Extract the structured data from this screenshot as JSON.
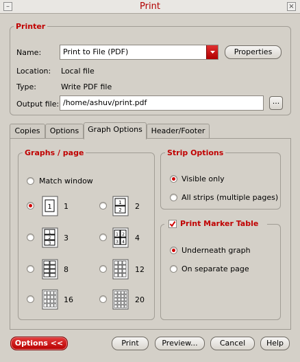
{
  "window": {
    "title": "Print",
    "minimize_glyph": "–",
    "close_glyph": "×"
  },
  "printer": {
    "group_title": "Printer",
    "name_label": "Name:",
    "name_value": "Print to File (PDF)",
    "properties_button": "Properties",
    "location_label": "Location:",
    "location_value": "Local file",
    "type_label": "Type:",
    "type_value": "Write PDF file",
    "output_label": "Output file:",
    "output_value": "/home/ashuv/print.pdf",
    "browse_button": "..."
  },
  "tabs": [
    {
      "label": "Copies",
      "active": false
    },
    {
      "label": "Options",
      "active": false
    },
    {
      "label": "Graph Options",
      "active": true
    },
    {
      "label": "Header/Footer",
      "active": false
    }
  ],
  "graphs_per_page": {
    "title": "Graphs / page",
    "match_window_label": "Match window",
    "options": [
      {
        "label": "1",
        "selected": true,
        "icon": "layout-1-icon"
      },
      {
        "label": "2",
        "selected": false,
        "icon": "layout-2-icon"
      },
      {
        "label": "3",
        "selected": false,
        "icon": "layout-3-icon"
      },
      {
        "label": "4",
        "selected": false,
        "icon": "layout-4-icon"
      },
      {
        "label": "8",
        "selected": false,
        "icon": "layout-8-icon"
      },
      {
        "label": "12",
        "selected": false,
        "icon": "layout-12-icon"
      },
      {
        "label": "16",
        "selected": false,
        "icon": "layout-16-icon"
      },
      {
        "label": "20",
        "selected": false,
        "icon": "layout-20-icon"
      }
    ]
  },
  "strip_options": {
    "title": "Strip Options",
    "visible_only": "Visible only",
    "all_strips": "All strips (multiple pages)",
    "selected": "visible_only"
  },
  "marker_table": {
    "title": "Print Marker Table",
    "checked": true,
    "underneath": "Underneath graph",
    "separate": "On separate page",
    "selected": "underneath"
  },
  "footer": {
    "options_button": "Options <<",
    "print_button": "Print",
    "preview_button": "Preview...",
    "cancel_button": "Cancel",
    "help_button": "Help"
  },
  "colors": {
    "accent": "#c00000",
    "background": "#d4d0c8"
  }
}
